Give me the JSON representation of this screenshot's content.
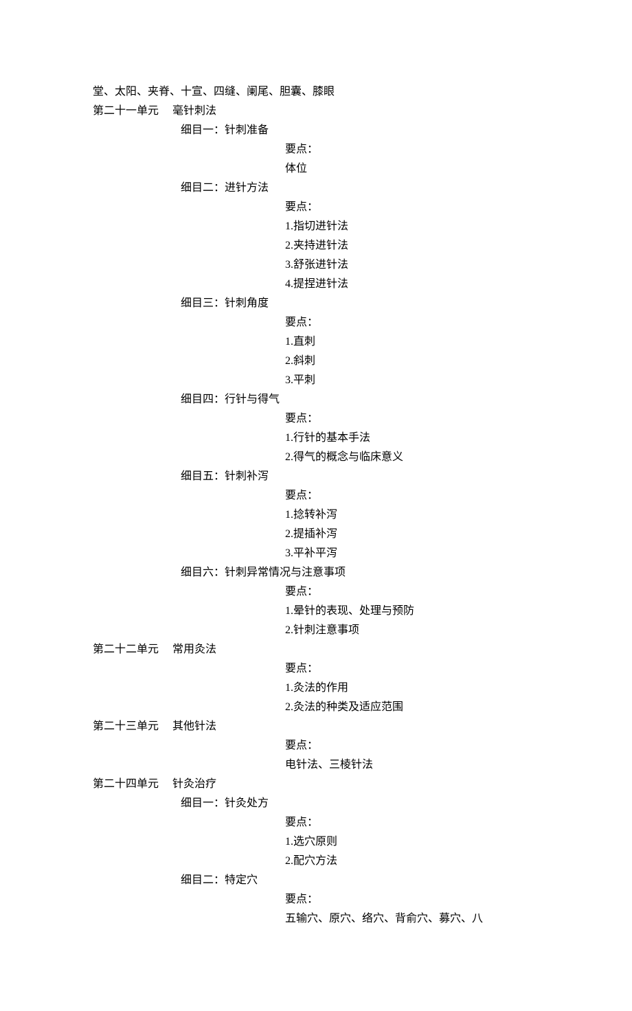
{
  "lines": [
    {
      "indent": 0,
      "text": "堂、太阳、夹脊、十宣、四缝、阑尾、胆囊、膝眼"
    },
    {
      "indent": 0,
      "text": "第二十一单元　 毫针刺法"
    },
    {
      "indent": 1,
      "text": "细目一：针刺准备"
    },
    {
      "indent": 2,
      "text": "要点："
    },
    {
      "indent": 2,
      "text": "体位"
    },
    {
      "indent": 1,
      "text": "细目二：进针方法"
    },
    {
      "indent": 2,
      "text": "要点："
    },
    {
      "indent": 2,
      "text": "1.指切进针法"
    },
    {
      "indent": 2,
      "text": "2.夹持进针法"
    },
    {
      "indent": 2,
      "text": "3.舒张进针法"
    },
    {
      "indent": 2,
      "text": "4.提捏进针法"
    },
    {
      "indent": 1,
      "text": "细目三：针刺角度"
    },
    {
      "indent": 2,
      "text": "要点："
    },
    {
      "indent": 2,
      "text": "1.直刺"
    },
    {
      "indent": 2,
      "text": "2.斜刺"
    },
    {
      "indent": 2,
      "text": "3.平刺"
    },
    {
      "indent": 1,
      "text": "细目四：行针与得气"
    },
    {
      "indent": 2,
      "text": "要点："
    },
    {
      "indent": 2,
      "text": "1.行针的基本手法"
    },
    {
      "indent": 2,
      "text": "2.得气的概念与临床意义"
    },
    {
      "indent": 1,
      "text": "细目五：针刺补泻"
    },
    {
      "indent": 2,
      "text": "要点："
    },
    {
      "indent": 2,
      "text": "1.捻转补泻"
    },
    {
      "indent": 2,
      "text": "2.提插补泻"
    },
    {
      "indent": 2,
      "text": "3.平补平泻"
    },
    {
      "indent": 1,
      "text": "细目六：针刺异常情况与注意事项"
    },
    {
      "indent": 2,
      "text": "要点："
    },
    {
      "indent": 2,
      "text": "1.晕针的表现、处理与预防"
    },
    {
      "indent": 2,
      "text": "2.针刺注意事项"
    },
    {
      "indent": 0,
      "text": "第二十二单元　 常用灸法"
    },
    {
      "indent": 2,
      "text": "要点："
    },
    {
      "indent": 2,
      "text": "1.灸法的作用"
    },
    {
      "indent": 2,
      "text": "2.灸法的种类及适应范围"
    },
    {
      "indent": 0,
      "text": "第二十三单元　 其他针法"
    },
    {
      "indent": 2,
      "text": "要点："
    },
    {
      "indent": 2,
      "text": "电针法、三棱针法"
    },
    {
      "indent": 0,
      "text": "第二十四单元　 针灸治疗"
    },
    {
      "indent": 1,
      "text": "细目一：针灸处方"
    },
    {
      "indent": 2,
      "text": "要点："
    },
    {
      "indent": 2,
      "text": "1.选穴原则"
    },
    {
      "indent": 2,
      "text": "2.配穴方法"
    },
    {
      "indent": 1,
      "text": "细目二：特定穴"
    },
    {
      "indent": 2,
      "text": "要点："
    },
    {
      "indent": 2,
      "text": "五输穴、原穴、络穴、背俞穴、募穴、八"
    }
  ]
}
